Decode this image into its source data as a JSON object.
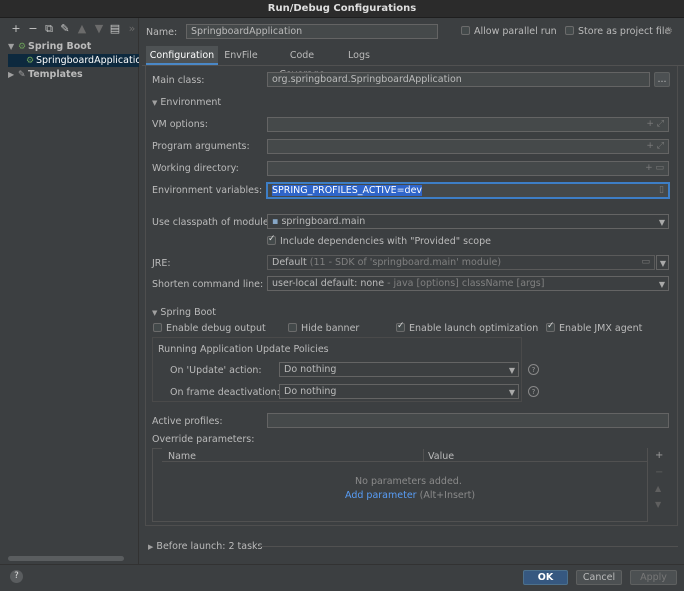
{
  "window": {
    "title": "Run/Debug Configurations"
  },
  "toolbar": {
    "icons": [
      "add-icon",
      "remove-icon",
      "copy-icon",
      "wrench-icon",
      "arrow-up-icon",
      "arrow-down-icon",
      "folder-icon",
      "more-icon"
    ]
  },
  "tree": {
    "group": "Spring Boot",
    "item": "SpringboardApplication",
    "templates": "Templates"
  },
  "header": {
    "name_label": "Name:",
    "name_value": "SpringboardApplication",
    "allow_parallel": "Allow parallel run",
    "store_as_file": "Store as project file"
  },
  "tabs": [
    "Configuration",
    "EnvFile",
    "Code Coverage",
    "Logs"
  ],
  "form": {
    "main_class_label": "Main class:",
    "main_class_value": "org.springboard.SpringboardApplication",
    "browse": "...",
    "environment_section": "Environment",
    "vm_options_label": "VM options:",
    "program_args_label": "Program arguments:",
    "working_dir_label": "Working directory:",
    "env_vars_label": "Environment variables:",
    "env_vars_value": "SPRING_PROFILES_ACTIVE=dev",
    "classpath_label": "Use classpath of module:",
    "classpath_value": "springboard.main",
    "include_provided": "Include dependencies with \"Provided\" scope",
    "jre_label": "JRE:",
    "jre_value": "Default",
    "jre_hint": "(11 - SDK of 'springboard.main' module)",
    "shorten_label": "Shorten command line:",
    "shorten_value": "user-local default: none",
    "shorten_hint": "- java [options] className [args]"
  },
  "spring_boot": {
    "section": "Spring Boot",
    "debug_output": "Enable debug output",
    "hide_banner": "Hide banner",
    "launch_opt": "Enable launch optimization",
    "jmx_agent": "Enable JMX agent",
    "update_policies": "Running Application Update Policies",
    "on_update_label": "On 'Update' action:",
    "on_update_value": "Do nothing",
    "on_frame_label": "On frame deactivation:",
    "on_frame_value": "Do nothing",
    "active_profiles_label": "Active profiles:",
    "override_label": "Override parameters:",
    "col_name": "Name",
    "col_value": "Value",
    "empty_text": "No parameters added.",
    "add_param": "Add parameter",
    "add_shortcut": "(Alt+Insert)"
  },
  "before_launch": "Before launch: 2 tasks",
  "buttons": {
    "ok": "OK",
    "cancel": "Cancel",
    "apply": "Apply",
    "help": "?"
  }
}
